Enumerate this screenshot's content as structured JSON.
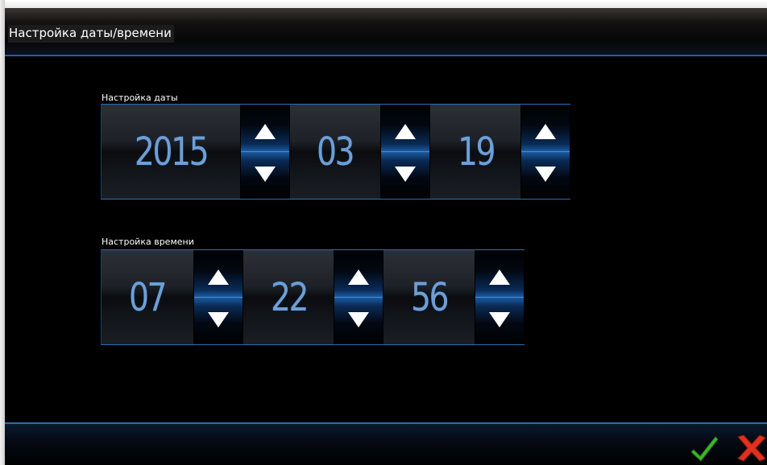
{
  "window": {
    "title": "Настройка даты/времени"
  },
  "date_group": {
    "label": "Настройка даты",
    "fields": [
      {
        "name": "year",
        "value": "2015"
      },
      {
        "name": "month",
        "value": "03"
      },
      {
        "name": "day",
        "value": "19"
      }
    ]
  },
  "time_group": {
    "label": "Настройка времени",
    "fields": [
      {
        "name": "hour",
        "value": "07"
      },
      {
        "name": "minute",
        "value": "22"
      },
      {
        "name": "second",
        "value": "56"
      }
    ]
  },
  "icons": {
    "ok": "checkmark-icon",
    "cancel": "close-icon",
    "increment": "triangle-up-icon",
    "decrement": "triangle-down-icon"
  },
  "colors": {
    "background": "#000000",
    "accent_blue": "#2c6fb8",
    "digit_color": "#6e9fd6",
    "ok_green": "#3fb52c",
    "cancel_red": "#e0301e"
  }
}
